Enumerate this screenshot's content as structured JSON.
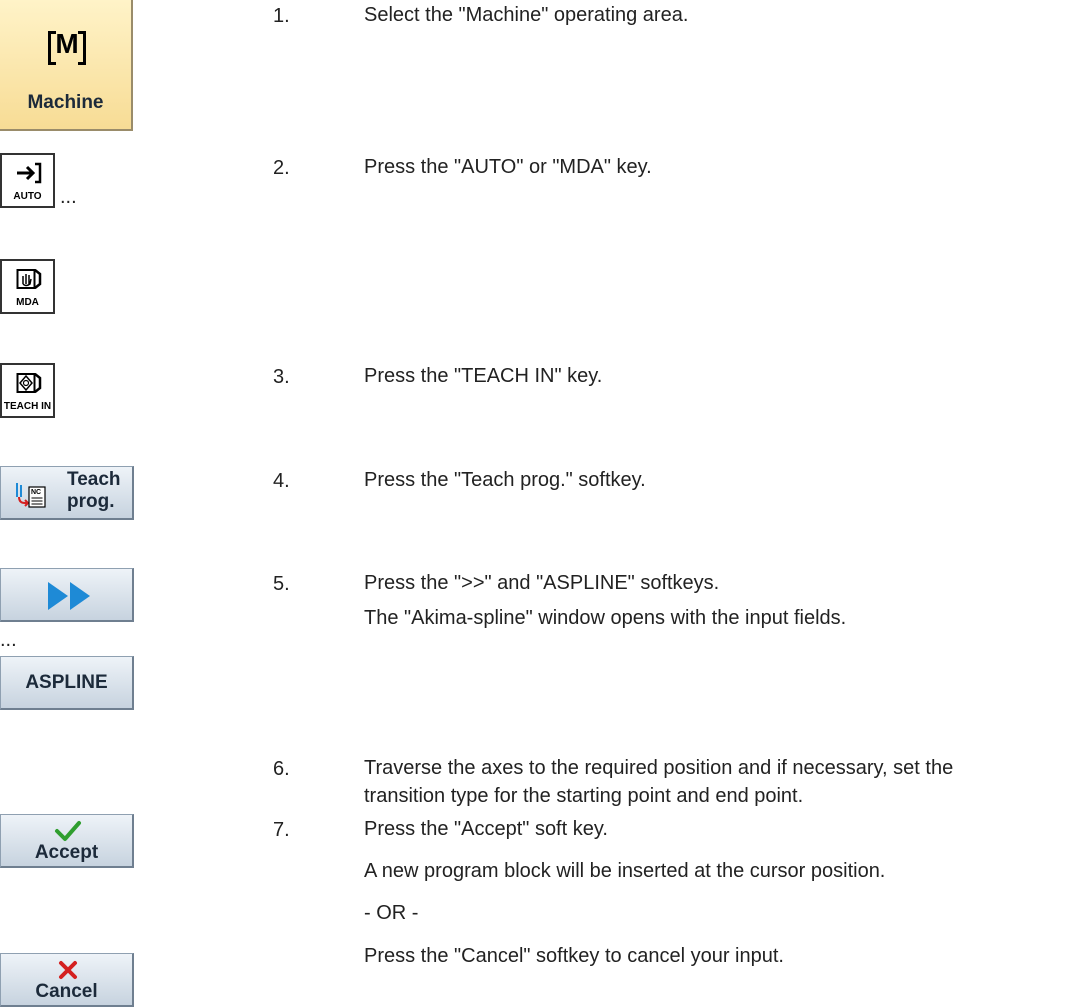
{
  "buttons": {
    "machine": "Machine",
    "machine_symbol": "M",
    "auto_key": "AUTO",
    "mda_key": "MDA",
    "teach_in_key": "TEACH IN",
    "teach_prog_line1": "Teach",
    "teach_prog_line2": "prog.",
    "teach_prog_badge": "NC",
    "aspline": "ASPLINE",
    "accept": "Accept",
    "cancel": "Cancel"
  },
  "ellipses": {
    "after_auto": "...",
    "after_forward": "..."
  },
  "steps": [
    {
      "num": "1.",
      "text": "Select the \"Machine\" operating area."
    },
    {
      "num": "2.",
      "text": "Press the \"AUTO\" or \"MDA\" key."
    },
    {
      "num": "3.",
      "text": "Press the \"TEACH IN\" key."
    },
    {
      "num": "4.",
      "text": "Press the \"Teach prog.\" softkey."
    },
    {
      "num": "5.",
      "text": "Press the \">>\" and \"ASPLINE\" softkeys.",
      "text2": "The \"Akima-spline\" window opens with the input fields."
    },
    {
      "num": "6.",
      "text": "Traverse the axes to the required position and if necessary, set the",
      "text2": "transition type for the starting point and end point."
    },
    {
      "num": "7.",
      "text": "Press the \"Accept\" soft key.",
      "text2": "A new program block will be inserted at the cursor position."
    }
  ],
  "or_text": "- OR -",
  "cancel_text": "Press the \"Cancel\" softkey to cancel your input.",
  "colors": {
    "machine_bg": "#f7dc95",
    "softkey_bg": "#c7d3df",
    "forward_arrow": "#1e8ad6",
    "accept_check": "#2f9e2f",
    "cancel_x": "#d42020"
  }
}
